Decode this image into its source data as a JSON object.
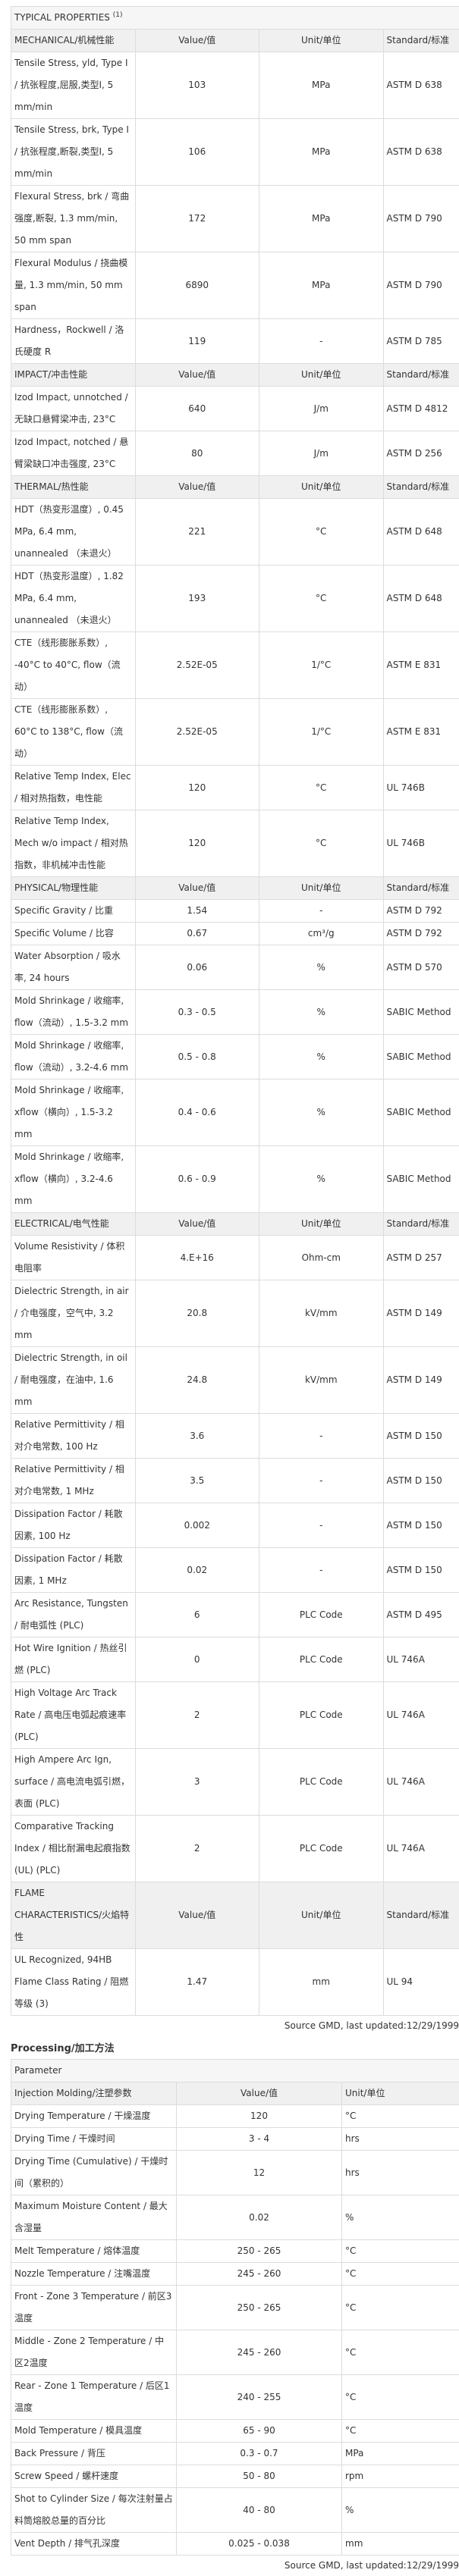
{
  "typical": {
    "title": "TYPICAL PROPERTIES",
    "title_sup": "(1)",
    "sections": [
      {
        "name": "MECHANICAL/机械性能",
        "headers": [
          "Value/值",
          "Unit/单位",
          "Standard/标准"
        ],
        "rows": [
          {
            "property": "Tensile Stress, yld, Type I / 抗张程度,屈服,类型I, 5 mm/min",
            "value": "103",
            "unit": "MPa",
            "standard": "ASTM D 638"
          },
          {
            "property": "Tensile Stress, brk, Type I / 抗张程度,断裂,类型I, 5 mm/min",
            "value": "106",
            "unit": "MPa",
            "standard": "ASTM D 638"
          },
          {
            "property": "Flexural Stress, brk / 弯曲强度,断裂, 1.3 mm/min, 50 mm span",
            "value": "172",
            "unit": "MPa",
            "standard": "ASTM D 790"
          },
          {
            "property": "Flexural Modulus / 挠曲模量, 1.3 mm/min, 50 mm span",
            "value": "6890",
            "unit": "MPa",
            "standard": "ASTM D 790"
          },
          {
            "property": "Hardness，Rockwell / 洛氏硬度 R",
            "value": "119",
            "unit": "-",
            "standard": "ASTM D 785"
          }
        ]
      },
      {
        "name": "IMPACT/冲击性能",
        "headers": [
          "Value/值",
          "Unit/单位",
          "Standard/标准"
        ],
        "rows": [
          {
            "property": "Izod Impact, unnotched / 无缺口悬臂梁冲击, 23°C",
            "value": "640",
            "unit": "J/m",
            "standard": "ASTM D 4812"
          },
          {
            "property": "Izod Impact, notched / 悬臂梁缺口冲击强度, 23°C",
            "value": "80",
            "unit": "J/m",
            "standard": "ASTM D 256"
          }
        ]
      },
      {
        "name": "THERMAL/热性能",
        "headers": [
          "Value/值",
          "Unit/单位",
          "Standard/标准"
        ],
        "rows": [
          {
            "property": "HDT（热变形温度）, 0.45 MPa, 6.4 mm, unannealed （未退火）",
            "value": "221",
            "unit": "°C",
            "standard": "ASTM D 648"
          },
          {
            "property": "HDT（热变形温度）, 1.82 MPa, 6.4 mm, unannealed （未退火）",
            "value": "193",
            "unit": "°C",
            "standard": "ASTM D 648"
          },
          {
            "property": "CTE（线形膨胀系数）, -40°C to 40°C, flow（流动）",
            "value": "2.52E-05",
            "unit": "1/°C",
            "standard": "ASTM E 831"
          },
          {
            "property": "CTE（线形膨胀系数）, 60°C to 138°C, flow（流动）",
            "value": "2.52E-05",
            "unit": "1/°C",
            "standard": "ASTM E 831"
          },
          {
            "property": "Relative Temp Index, Elec / 相对热指数，电性能",
            "value": "120",
            "unit": "°C",
            "standard": "UL 746B"
          },
          {
            "property": "Relative Temp Index, Mech w/o impact / 相对热指数，非机械冲击性能",
            "value": "120",
            "unit": "°C",
            "standard": "UL 746B"
          }
        ]
      },
      {
        "name": "PHYSICAL/物理性能",
        "headers": [
          "Value/值",
          "Unit/单位",
          "Standard/标准"
        ],
        "rows": [
          {
            "property": "Specific Gravity / 比重",
            "value": "1.54",
            "unit": "-",
            "standard": "ASTM D 792"
          },
          {
            "property": "Specific Volume / 比容",
            "value": "0.67",
            "unit": "cm³/g",
            "standard": "ASTM D 792"
          },
          {
            "property": "Water Absorption / 吸水率, 24 hours",
            "value": "0.06",
            "unit": "%",
            "standard": "ASTM D 570"
          },
          {
            "property": "Mold Shrinkage / 收缩率, flow（流动）, 1.5-3.2 mm",
            "value": "0.3 - 0.5",
            "unit": "%",
            "standard": "SABIC Method"
          },
          {
            "property": "Mold Shrinkage / 收缩率, flow（流动）, 3.2-4.6 mm",
            "value": "0.5 - 0.8",
            "unit": "%",
            "standard": "SABIC Method"
          },
          {
            "property": "Mold Shrinkage / 收缩率, xflow（横向）, 1.5-3.2 mm",
            "value": "0.4 - 0.6",
            "unit": "%",
            "standard": "SABIC Method"
          },
          {
            "property": "Mold Shrinkage / 收缩率, xflow（横向）, 3.2-4.6 mm",
            "value": "0.6 - 0.9",
            "unit": "%",
            "standard": "SABIC Method"
          }
        ]
      },
      {
        "name": "ELECTRICAL/电气性能",
        "headers": [
          "Value/值",
          "Unit/单位",
          "Standard/标准"
        ],
        "rows": [
          {
            "property": "Volume Resistivity / 体积电阻率",
            "value": "4.E+16",
            "unit": "Ohm-cm",
            "standard": "ASTM D 257"
          },
          {
            "property": "Dielectric Strength, in air / 介电强度，空气中, 3.2 mm",
            "value": "20.8",
            "unit": "kV/mm",
            "standard": "ASTM D 149"
          },
          {
            "property": "Dielectric Strength, in oil / 耐电强度，在油中, 1.6 mm",
            "value": "24.8",
            "unit": "kV/mm",
            "standard": "ASTM D 149"
          },
          {
            "property": "Relative Permittivity / 相对介电常数, 100 Hz",
            "value": "3.6",
            "unit": "-",
            "standard": "ASTM D 150"
          },
          {
            "property": "Relative Permittivity / 相对介电常数, 1 MHz",
            "value": "3.5",
            "unit": "-",
            "standard": "ASTM D 150"
          },
          {
            "property": "Dissipation Factor / 耗散因素, 100 Hz",
            "value": "0.002",
            "unit": "-",
            "standard": "ASTM D 150"
          },
          {
            "property": "Dissipation Factor / 耗散因素, 1 MHz",
            "value": "0.02",
            "unit": "-",
            "standard": "ASTM D 150"
          },
          {
            "property": "Arc Resistance, Tungsten / 耐电弧性 (PLC)",
            "value": "6",
            "unit": "PLC Code",
            "standard": "ASTM D 495"
          },
          {
            "property": "Hot Wire Ignition / 热丝引燃 (PLC)",
            "value": "0",
            "unit": "PLC Code",
            "standard": "UL 746A"
          },
          {
            "property": "High Voltage Arc Track Rate / 高电压电弧起痕速率 (PLC)",
            "value": "2",
            "unit": "PLC Code",
            "standard": "UL 746A"
          },
          {
            "property": "High Ampere Arc Ign, surface / 高电流电弧引燃，表面 (PLC)",
            "value": "3",
            "unit": "PLC Code",
            "standard": "UL 746A"
          },
          {
            "property": "Comparative Tracking Index / 相比耐漏电起痕指数 (UL) (PLC)",
            "value": "2",
            "unit": "PLC Code",
            "standard": "UL 746A"
          }
        ]
      },
      {
        "name": "FLAME CHARACTERISTICS/火焰特性",
        "headers": [
          "Value/值",
          "Unit/单位",
          "Standard/标准"
        ],
        "rows": [
          {
            "property": "UL Recognized, 94HB Flame Class Rating / 阻燃等级 (3)",
            "value": "1.47",
            "unit": "mm",
            "standard": "UL 94"
          }
        ]
      }
    ],
    "source": "Source GMD, last updated:12/29/1999"
  },
  "processing": {
    "title": "Processing/加工方法",
    "parameter_header": "Parameter",
    "section": "Injection Molding/注塑参数",
    "headers": [
      "Value/值",
      "Unit/单位"
    ],
    "rows": [
      {
        "property": "Drying Temperature / 干燥温度",
        "value": "120",
        "unit": "°C"
      },
      {
        "property": "Drying Time / 干燥时间",
        "value": "3 - 4",
        "unit": "hrs"
      },
      {
        "property": "Drying Time (Cumulative) / 干燥时间（累积的）",
        "value": "12",
        "unit": "hrs"
      },
      {
        "property": "Maximum Moisture Content / 最大含湿量",
        "value": "0.02",
        "unit": "%"
      },
      {
        "property": "Melt Temperature / 熔体温度",
        "value": "250 - 265",
        "unit": "°C"
      },
      {
        "property": "Nozzle Temperature / 注嘴温度",
        "value": "245 - 260",
        "unit": "°C"
      },
      {
        "property": "Front - Zone 3 Temperature / 前区3温度",
        "value": "250 - 265",
        "unit": "°C"
      },
      {
        "property": "Middle - Zone 2 Temperature / 中区2温度",
        "value": "245 - 260",
        "unit": "°C"
      },
      {
        "property": "Rear - Zone 1 Temperature / 后区1温度",
        "value": "240 - 255",
        "unit": "°C"
      },
      {
        "property": "Mold Temperature / 模具温度",
        "value": "65 - 90",
        "unit": "°C"
      },
      {
        "property": "Back Pressure / 背压",
        "value": "0.3 - 0.7",
        "unit": "MPa"
      },
      {
        "property": "Screw Speed / 螺杆速度",
        "value": "50 - 80",
        "unit": "rpm"
      },
      {
        "property": "Shot to Cylinder Size / 每次注射量占料筒熔胶总量的百分比",
        "value": "40 - 80",
        "unit": "%"
      },
      {
        "property": "Vent Depth / 排气孔深度",
        "value": "0.025 - 0.038",
        "unit": "mm"
      }
    ],
    "source": "Source GMD, last updated:12/29/1999"
  }
}
